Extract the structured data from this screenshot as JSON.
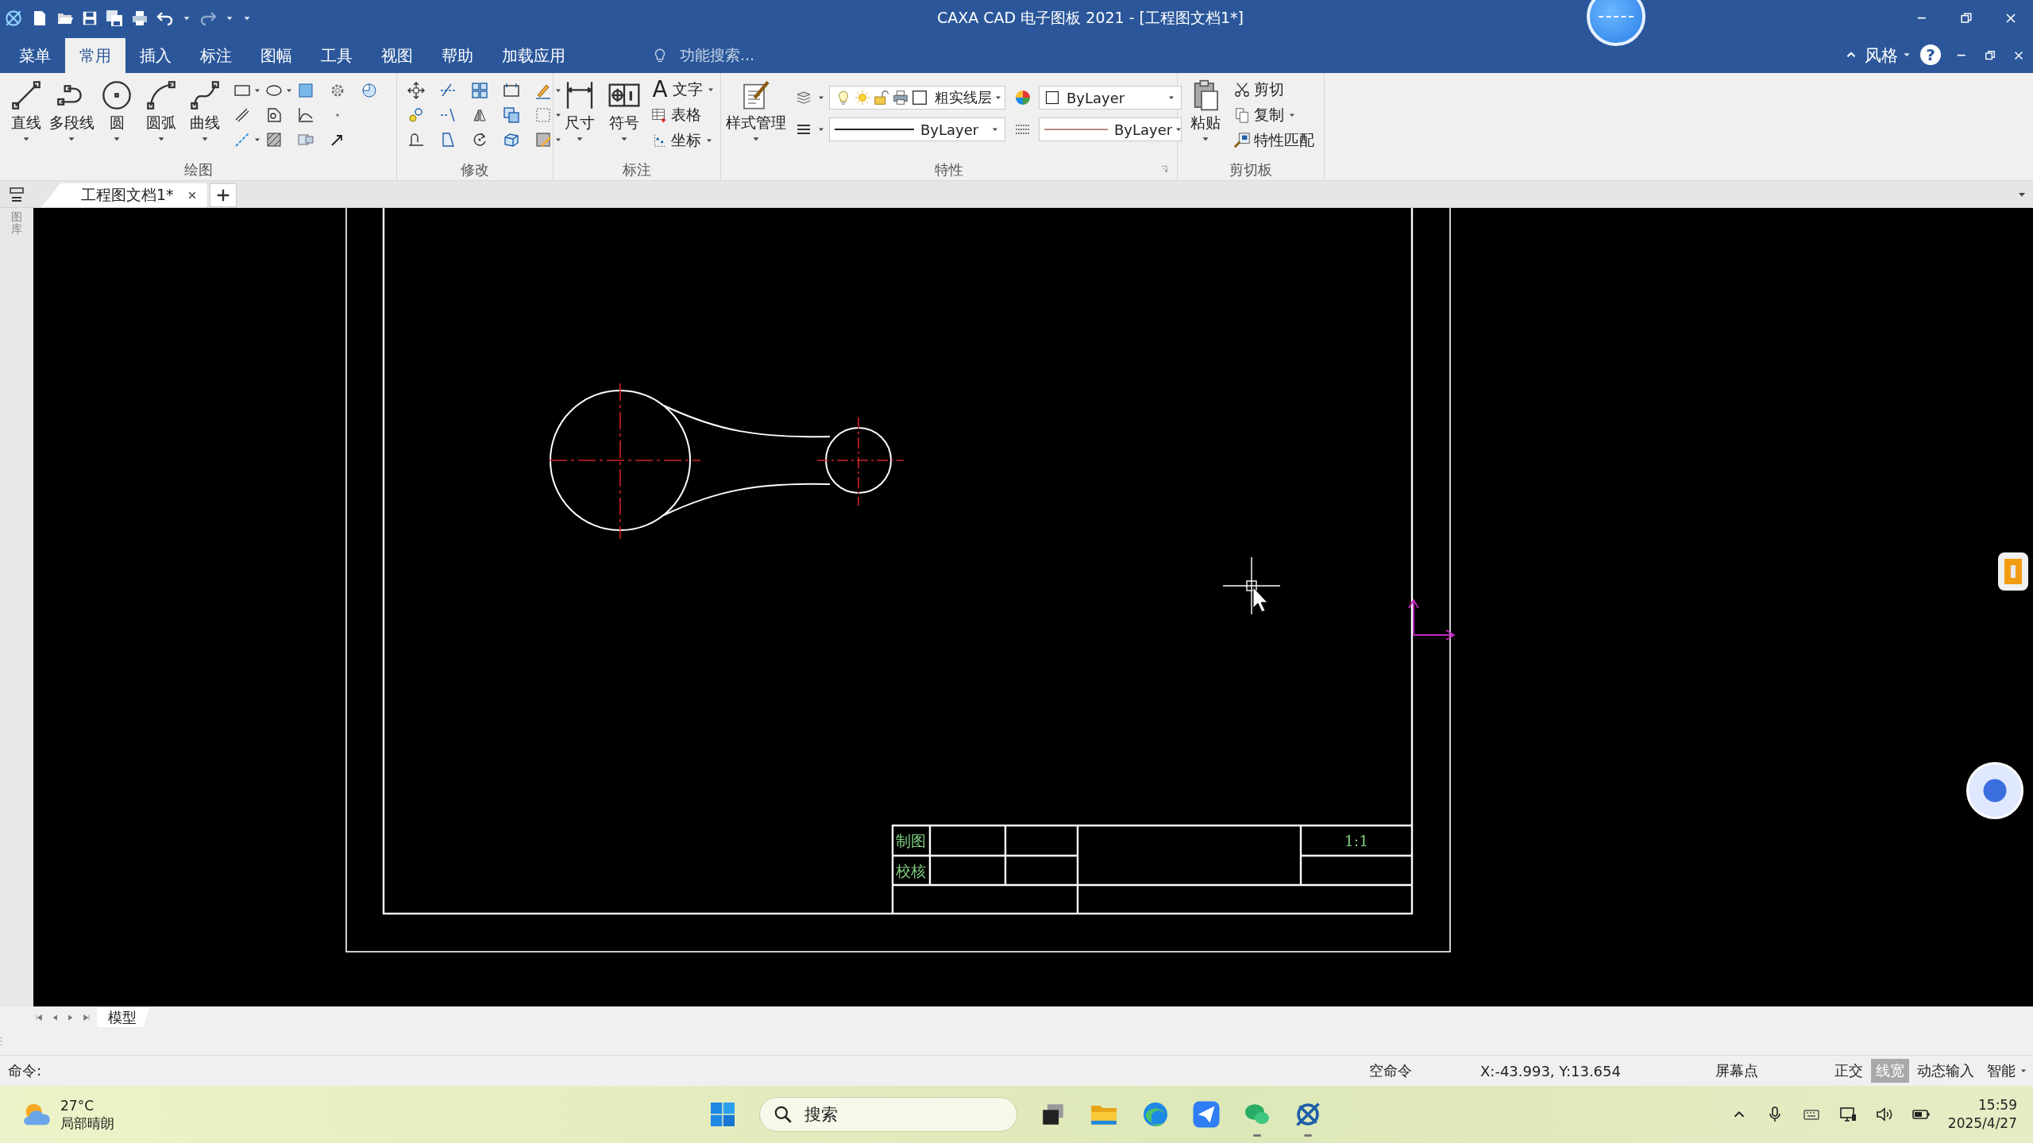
{
  "window": {
    "title": "CAXA CAD 电子图板 2021 - [工程图文档1*]"
  },
  "menu_tabs": [
    {
      "label": "菜单",
      "selected": false
    },
    {
      "label": "常用",
      "selected": true
    },
    {
      "label": "插入",
      "selected": false
    },
    {
      "label": "标注",
      "selected": false
    },
    {
      "label": "图幅",
      "selected": false
    },
    {
      "label": "工具",
      "selected": false
    },
    {
      "label": "视图",
      "selected": false
    },
    {
      "label": "帮助",
      "selected": false
    },
    {
      "label": "加载应用",
      "selected": false
    }
  ],
  "search": {
    "placeholder": "功能搜索..."
  },
  "style_menu": {
    "label": "风格",
    "help": "?"
  },
  "ribbon": {
    "groups": [
      {
        "kind": "draw",
        "label": "绘图",
        "tools": [
          "直线",
          "多段线",
          "圆",
          "圆弧",
          "曲线"
        ]
      },
      {
        "kind": "modify",
        "label": "修改"
      },
      {
        "kind": "annotate",
        "label": "标注",
        "tools": [
          "尺寸",
          "符号"
        ],
        "text_glyph": "A",
        "small_tools": [
          "文字",
          "表格",
          "坐标"
        ]
      },
      {
        "kind": "properties",
        "label": "特性",
        "tools": [
          "样式管理"
        ],
        "layer": "粗实线层",
        "color_setting": "ByLayer",
        "linetype": "ByLayer",
        "lineweight": "ByLayer"
      },
      {
        "kind": "clipboard",
        "label": "剪切板",
        "tools": [
          "粘贴"
        ],
        "small_tools": [
          "剪切",
          "复制",
          "特性匹配"
        ]
      }
    ]
  },
  "documents": [
    {
      "label": "工程图文档1*",
      "selected": true
    }
  ],
  "side_panel": {
    "label": "图库"
  },
  "title_block": {
    "drafter_label": "制图",
    "checker_label": "校核",
    "scale": "1:1"
  },
  "layouts": [
    {
      "label": "模型",
      "selected": true
    }
  ],
  "command_line": {
    "prompt": "命令:"
  },
  "status_bar": {
    "command": "空命令",
    "coordinates": "X:-43.993, Y:13.654",
    "snap_mode": "屏幕点",
    "toggles": [
      {
        "label": "正交",
        "on": false
      },
      {
        "label": "线宽",
        "on": true
      },
      {
        "label": "动态输入",
        "on": false
      }
    ],
    "snap_setting": "智能"
  },
  "taskbar": {
    "weather": {
      "temperature": "27°C",
      "condition": "局部晴朗"
    },
    "search": {
      "placeholder": "搜索"
    },
    "time": "15:59",
    "date": "2025/4/27"
  }
}
